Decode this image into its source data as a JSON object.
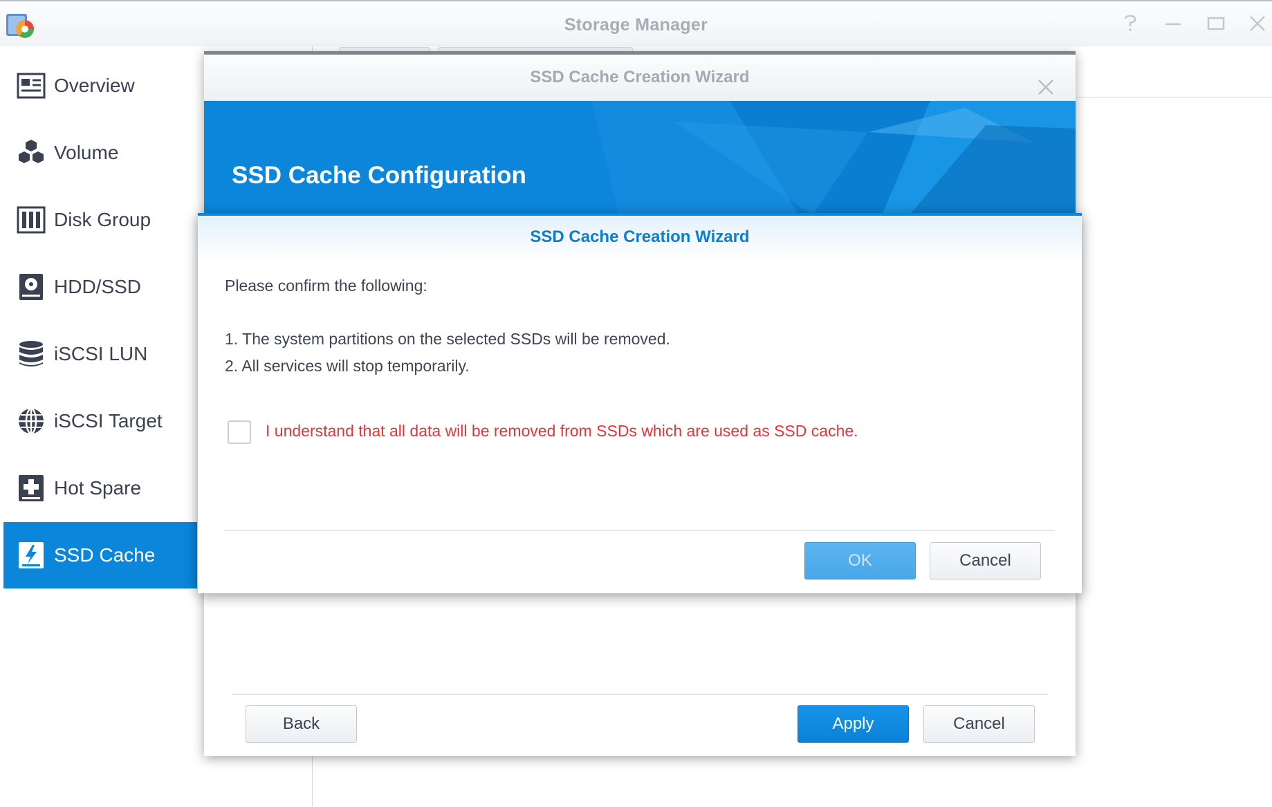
{
  "app": {
    "title": "Storage Manager"
  },
  "window_controls": [
    "help-icon",
    "minimize-icon",
    "maximize-icon",
    "close-icon"
  ],
  "sidebar": {
    "items": [
      {
        "label": "Overview",
        "icon": "overview-icon",
        "active": false
      },
      {
        "label": "Volume",
        "icon": "volume-icon",
        "active": false
      },
      {
        "label": "Disk Group",
        "icon": "disk-group-icon",
        "active": false
      },
      {
        "label": "HDD/SSD",
        "icon": "hdd-ssd-icon",
        "active": false
      },
      {
        "label": "iSCSI LUN",
        "icon": "iscsi-lun-icon",
        "active": false
      },
      {
        "label": "iSCSI Target",
        "icon": "iscsi-target-icon",
        "active": false
      },
      {
        "label": "Hot Spare",
        "icon": "hot-spare-icon",
        "active": false
      },
      {
        "label": "SSD Cache",
        "icon": "ssd-cache-icon",
        "active": true
      }
    ]
  },
  "wizard": {
    "title": "SSD Cache Creation Wizard",
    "heading": "SSD Cache Configuration",
    "back_label": "Back",
    "apply_label": "Apply",
    "cancel_label": "Cancel"
  },
  "confirm_dialog": {
    "title": "SSD Cache Creation Wizard",
    "intro": "Please confirm the following:",
    "items": [
      "1. The system partitions on the selected SSDs will be removed.",
      "2. All services will stop temporarily."
    ],
    "checkbox_checked": false,
    "checkbox_label": "I understand that all data will be removed from SSDs which are used as SSD cache.",
    "ok_label": "OK",
    "ok_disabled": true,
    "cancel_label": "Cancel"
  },
  "colors": {
    "accent": "#0b86db",
    "warning": "#e2363a",
    "title_gray": "#a7adb5"
  }
}
